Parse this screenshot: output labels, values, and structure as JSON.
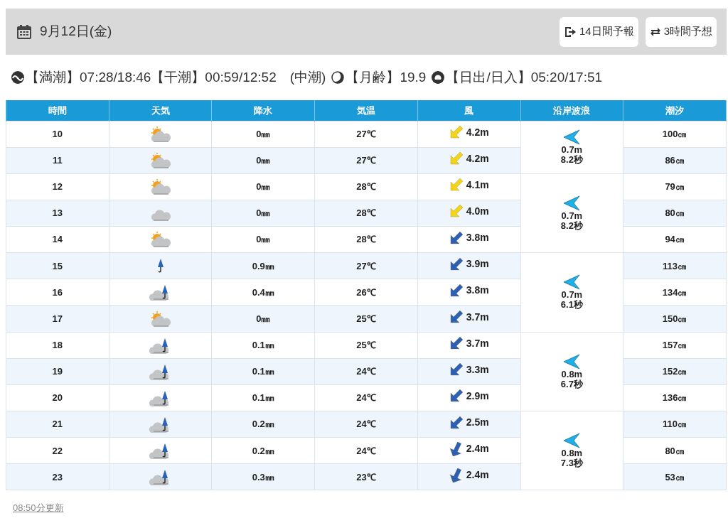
{
  "header": {
    "date": "9月12日(金)",
    "buttons": [
      {
        "label": "14日間予報",
        "kind": "exit"
      },
      {
        "label": "3時間予想",
        "kind": "swap"
      }
    ]
  },
  "info": [
    {
      "kind": "tide",
      "text": "【満潮】07:28/18:46【干潮】00:59/12:52　(中潮)"
    },
    {
      "kind": "moon",
      "text": "【月齢】19.9"
    },
    {
      "kind": "sun",
      "text": "【日出/日入】05:20/17:51"
    }
  ],
  "table": {
    "columns": [
      "時間",
      "天気",
      "降水",
      "気温",
      "風",
      "沿岸波浪",
      "潮汐"
    ],
    "rows": [
      {
        "hour": "10",
        "weather": {
          "kind": "partly-cloudy"
        },
        "rain": "0㎜",
        "temp": "27℃",
        "wind": {
          "speed": "4.2m",
          "color": "#f2d41c",
          "kind": "diagonal"
        },
        "wave": {
          "height": "0.7m",
          "period": "8.2秒"
        },
        "tide": "100㎝"
      },
      {
        "hour": "11",
        "weather": {
          "kind": "partly-cloudy"
        },
        "rain": "0㎜",
        "temp": "27℃",
        "wind": {
          "speed": "4.2m",
          "color": "#f2d41c",
          "kind": "diagonal"
        },
        "tide": "86㎝"
      },
      {
        "hour": "12",
        "weather": {
          "kind": "partly-cloudy"
        },
        "rain": "0㎜",
        "temp": "28℃",
        "wind": {
          "speed": "4.1m",
          "color": "#f2d41c",
          "kind": "diagonal"
        },
        "wave": {
          "height": "0.7m",
          "period": "8.2秒"
        },
        "tide": "79㎝"
      },
      {
        "hour": "13",
        "weather": {
          "kind": "cloudy"
        },
        "rain": "0㎜",
        "temp": "28℃",
        "wind": {
          "speed": "4.0m",
          "color": "#f2d41c",
          "kind": "diagonal"
        },
        "tide": "80㎝"
      },
      {
        "hour": "14",
        "weather": {
          "kind": "partly-cloudy"
        },
        "rain": "0㎜",
        "temp": "28℃",
        "wind": {
          "speed": "3.8m",
          "color": "#2c5fb5",
          "kind": "diagonal"
        },
        "tide": "94㎝"
      },
      {
        "hour": "15",
        "weather": {
          "kind": "rain"
        },
        "rain": "0.9㎜",
        "temp": "27℃",
        "wind": {
          "speed": "3.9m",
          "color": "#2c5fb5",
          "kind": "diagonal"
        },
        "wave": {
          "height": "0.7m",
          "period": "6.1秒"
        },
        "tide": "113㎝"
      },
      {
        "hour": "16",
        "weather": {
          "kind": "cloudy-rain"
        },
        "rain": "0.4㎜",
        "temp": "26℃",
        "wind": {
          "speed": "3.8m",
          "color": "#2c5fb5",
          "kind": "diagonal"
        },
        "tide": "134㎝"
      },
      {
        "hour": "17",
        "weather": {
          "kind": "partly-cloudy"
        },
        "rain": "0㎜",
        "temp": "25℃",
        "wind": {
          "speed": "3.7m",
          "color": "#2c5fb5",
          "kind": "diagonal"
        },
        "tide": "150㎝"
      },
      {
        "hour": "18",
        "weather": {
          "kind": "cloudy-rain"
        },
        "rain": "0.1㎜",
        "temp": "25℃",
        "wind": {
          "speed": "3.7m",
          "color": "#2c5fb5",
          "kind": "diagonal"
        },
        "wave": {
          "height": "0.8m",
          "period": "6.7秒"
        },
        "tide": "157㎝"
      },
      {
        "hour": "19",
        "weather": {
          "kind": "cloudy-rain"
        },
        "rain": "0.1㎜",
        "temp": "24℃",
        "wind": {
          "speed": "3.3m",
          "color": "#2c5fb5",
          "kind": "diagonal"
        },
        "tide": "152㎝"
      },
      {
        "hour": "20",
        "weather": {
          "kind": "cloudy-rain"
        },
        "rain": "0.1㎜",
        "temp": "24℃",
        "wind": {
          "speed": "2.9m",
          "color": "#2c5fb5",
          "kind": "diagonal"
        },
        "tide": "136㎝"
      },
      {
        "hour": "21",
        "weather": {
          "kind": "cloudy-rain"
        },
        "rain": "0.2㎜",
        "temp": "24℃",
        "wind": {
          "speed": "2.5m",
          "color": "#2c5fb5",
          "kind": "diagonal"
        },
        "wave": {
          "height": "0.8m",
          "period": "7.3秒"
        },
        "tide": "110㎝"
      },
      {
        "hour": "22",
        "weather": {
          "kind": "cloudy-rain"
        },
        "rain": "0.2㎜",
        "temp": "24℃",
        "wind": {
          "speed": "2.4m",
          "color": "#2c5fb5",
          "kind": "steep"
        },
        "tide": "80㎝"
      },
      {
        "hour": "23",
        "weather": {
          "kind": "cloudy-rain"
        },
        "rain": "0.3㎜",
        "temp": "23℃",
        "wind": {
          "speed": "2.4m",
          "color": "#2c5fb5",
          "kind": "steep"
        },
        "tide": "53㎝"
      }
    ]
  },
  "footer": {
    "updated": "08:50分更新"
  }
}
